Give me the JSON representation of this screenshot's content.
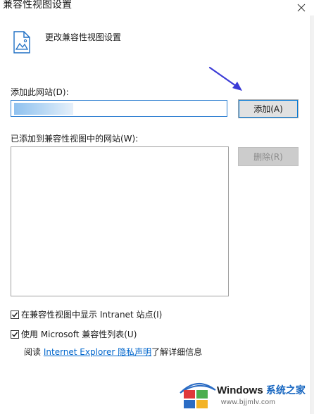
{
  "window": {
    "title": "兼容性视图设置",
    "close_icon": "close-icon"
  },
  "header": {
    "icon": "page-icon",
    "text": "更改兼容性视图设置"
  },
  "add_site": {
    "label": "添加此网站(D):",
    "value": "",
    "add_button_label": "添加(A)"
  },
  "site_list": {
    "label": "已添加到兼容性视图中的网站(W):",
    "items": [],
    "remove_button_label": "删除(R)"
  },
  "options": {
    "intranet": {
      "label": "在兼容性视图中显示 Intranet 站点(I)",
      "checked": true
    },
    "ms_list": {
      "label": "使用 Microsoft 兼容性列表(U)",
      "checked": true
    }
  },
  "privacy": {
    "prefix": "阅读",
    "link": "Internet Explorer 隐私声明",
    "suffix": "了解详细信息"
  },
  "annotation": {
    "arrow_color": "#3b3bd6"
  },
  "watermark": {
    "brand": "Windows",
    "brand_cn": "系统之家",
    "url": "www.bjjmlv.com"
  },
  "colors": {
    "input_border": "#2f7fd1",
    "button_face": "#e1e1e1",
    "disabled_button": "#cccccc",
    "link": "#0066cc"
  }
}
